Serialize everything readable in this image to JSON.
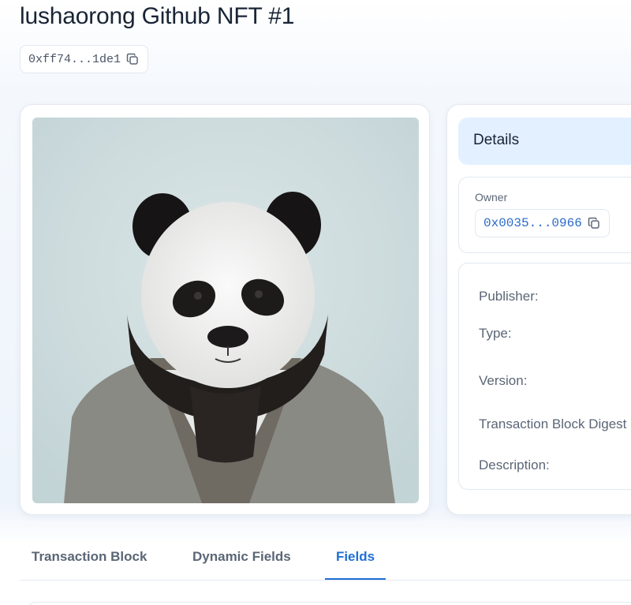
{
  "page": {
    "title": "lushaorong Github NFT #1",
    "object_id": "0xff74...1de1"
  },
  "icons": {
    "copy": "copy-icon"
  },
  "details": {
    "header": "Details",
    "owner_label": "Owner",
    "owner_address": "0x0035...0966",
    "fields": [
      {
        "label": "Publisher:"
      },
      {
        "label": "Type:"
      },
      {
        "label": "Version:"
      },
      {
        "label": "Transaction Block Digest"
      },
      {
        "label": "Description:"
      }
    ]
  },
  "tabs": [
    {
      "label": "Transaction Block",
      "active": false
    },
    {
      "label": "Dynamic Fields",
      "active": false
    },
    {
      "label": "Fields",
      "active": true
    }
  ],
  "colors": {
    "accent": "#1f6fd6",
    "details_header_bg": "#e3f0ff",
    "address_text": "#2a6ac9"
  }
}
